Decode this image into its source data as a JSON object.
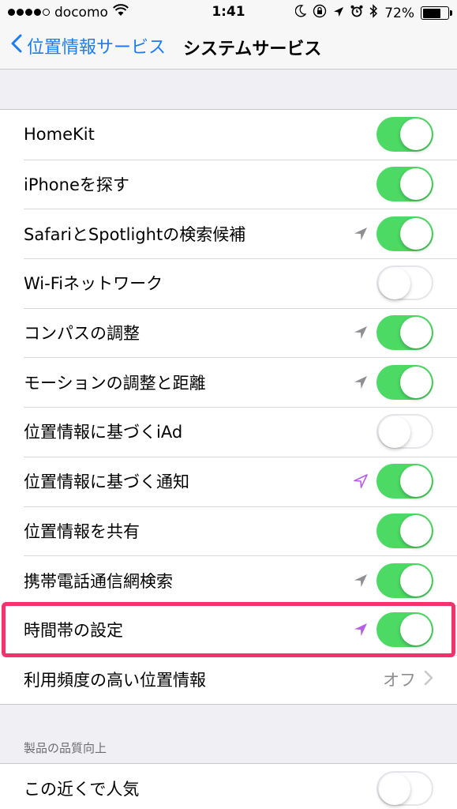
{
  "status_bar": {
    "carrier": "docomo",
    "time": "1:41",
    "battery": "72%",
    "battery_fraction": 0.72
  },
  "nav": {
    "back_label": "位置情報サービス",
    "title": "システムサービス"
  },
  "rows": [
    {
      "label": "HomeKit",
      "toggle": true,
      "location_icon": "none"
    },
    {
      "label": "iPhoneを探す",
      "toggle": true,
      "location_icon": "none"
    },
    {
      "label": "SafariとSpotlightの検索候補",
      "toggle": true,
      "location_icon": "gray"
    },
    {
      "label": "Wi-Fiネットワーク",
      "toggle": false,
      "location_icon": "none"
    },
    {
      "label": "コンパスの調整",
      "toggle": true,
      "location_icon": "gray"
    },
    {
      "label": "モーションの調整と距離",
      "toggle": true,
      "location_icon": "gray"
    },
    {
      "label": "位置情報に基づくiAd",
      "toggle": false,
      "location_icon": "none"
    },
    {
      "label": "位置情報に基づく通知",
      "toggle": true,
      "location_icon": "purple-outline"
    },
    {
      "label": "位置情報を共有",
      "toggle": true,
      "location_icon": "none"
    },
    {
      "label": "携帯電話通信網検索",
      "toggle": true,
      "location_icon": "gray"
    },
    {
      "label": "時間帯の設定",
      "toggle": true,
      "location_icon": "purple"
    },
    {
      "label": "利用頻度の高い位置情報",
      "value": "オフ",
      "disclosure": true
    }
  ],
  "section_header": "製品の品質向上",
  "rows2": [
    {
      "label": "この近くで人気",
      "toggle": false
    }
  ],
  "colors": {
    "toggle_on": "#4cd964",
    "link_blue": "#1d7cf2",
    "highlight": "#f5326e",
    "location_gray": "#8e8e93",
    "location_purple": "#b45ee9"
  }
}
